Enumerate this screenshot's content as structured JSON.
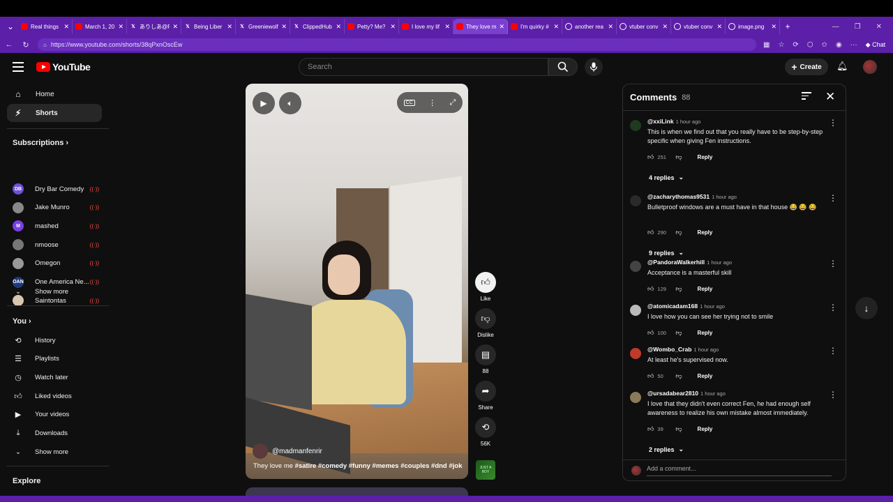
{
  "browser": {
    "tabs": [
      {
        "label": "Real things",
        "favicon": "youtube-icon",
        "active": false
      },
      {
        "label": "March 1, 20",
        "favicon": "youtube-icon",
        "active": false
      },
      {
        "label": "ありしあ@Re",
        "favicon": "x-icon",
        "active": false
      },
      {
        "label": "Being Liber",
        "favicon": "x-icon",
        "active": false
      },
      {
        "label": "Greeniewolf",
        "favicon": "x-icon",
        "active": false
      },
      {
        "label": "ClippedHub",
        "favicon": "x-icon",
        "active": false
      },
      {
        "label": "Petty? Me?",
        "favicon": "youtube-icon",
        "active": false
      },
      {
        "label": "I love my lif",
        "favicon": "youtube-icon",
        "active": false
      },
      {
        "label": "They love m",
        "favicon": "youtube-icon",
        "active": true
      },
      {
        "label": "I'm quirky #",
        "favicon": "youtube-icon",
        "active": false
      },
      {
        "label": "another rea",
        "favicon": "globe-icon",
        "active": false
      },
      {
        "label": "vtuber conv",
        "favicon": "globe-icon",
        "active": false
      },
      {
        "label": "vtuber conv",
        "favicon": "globe-icon",
        "active": false
      },
      {
        "label": "image.png",
        "favicon": "globe-icon",
        "active": false
      }
    ],
    "url": "https://www.youtube.com/shorts/38qPxnOscEw",
    "chat_label": "Chat"
  },
  "masthead": {
    "logo_text": "YouTube",
    "search_placeholder": "Search",
    "create_label": "Create"
  },
  "sidebar": {
    "main": [
      {
        "label": "Home",
        "icon": "home-icon",
        "active": false
      },
      {
        "label": "Shorts",
        "icon": "shorts-icon",
        "active": true
      }
    ],
    "subscriptions_title": "Subscriptions",
    "subscriptions": [
      {
        "label": "Dry Bar Comedy",
        "avatar_text": "DB",
        "color": "#6f4fd8"
      },
      {
        "label": "Jake Munro",
        "avatar_text": "",
        "color": "#888888"
      },
      {
        "label": "mashed",
        "avatar_text": "M",
        "color": "#7b3fe4"
      },
      {
        "label": "nmoose",
        "avatar_text": "",
        "color": "#777777"
      },
      {
        "label": "Omegon",
        "avatar_text": "",
        "color": "#999999"
      },
      {
        "label": "One America Ne...",
        "avatar_text": "OAN",
        "color": "#1f3a7a"
      },
      {
        "label": "Saintontas",
        "avatar_text": "",
        "color": "#d8c7b0"
      }
    ],
    "show_more": "Show more",
    "you_title": "You",
    "you_items": [
      {
        "label": "History",
        "icon": "history-icon"
      },
      {
        "label": "Playlists",
        "icon": "playlists-icon"
      },
      {
        "label": "Watch later",
        "icon": "clock-icon"
      },
      {
        "label": "Liked videos",
        "icon": "thumbs-up-icon"
      },
      {
        "label": "Your videos",
        "icon": "play-square-icon"
      },
      {
        "label": "Downloads",
        "icon": "download-icon"
      }
    ],
    "show_more_2": "Show more",
    "explore_title": "Explore"
  },
  "short": {
    "channel": "@madmanfenrir",
    "caption_title": "They love me",
    "hashtags": "#satire #comedy #funny #memes #couples #dnd #joke...",
    "actions": {
      "like_label": "Like",
      "dislike_label": "Dislike",
      "comments_count": "88",
      "share_label": "Share",
      "remix_count": "56K"
    },
    "sound_thumb_text": "JUST A BOY"
  },
  "comments": {
    "title": "Comments",
    "count": "88",
    "reply_label": "Reply",
    "add_placeholder": "Add a comment...",
    "items": [
      {
        "user": "@xxiLink",
        "time": "1 hour ago",
        "text": "This is when we find out that you really have to be step-by-step specific when giving Fen instructions.",
        "likes": "251",
        "replies": "4 replies",
        "avatar_color": "#1f3a1f"
      },
      {
        "user": "@zacharythomas9531",
        "time": "1 hour ago",
        "text": "Bulletproof windows are a must have in that house 😂 😂 😂",
        "likes": "290",
        "replies": "9 replies",
        "avatar_color": "#2a2a2a"
      },
      {
        "user": "@PandoraWalkerhill",
        "time": "1 hour ago",
        "text": "Acceptance is a masterful skill",
        "likes": "129",
        "replies": "",
        "avatar_color": "#444444"
      },
      {
        "user": "@atomicadam168",
        "time": "1 hour ago",
        "text": "I love how you can see her trying not to smile",
        "likes": "100",
        "replies": "",
        "avatar_color": "#bbbbbb"
      },
      {
        "user": "@Wombo_Crab",
        "time": "1 hour ago",
        "text": "At least he's supervised now.",
        "likes": "50",
        "replies": "",
        "avatar_color": "#c0392b"
      },
      {
        "user": "@ursadabear2810",
        "time": "1 hour ago",
        "text": "I love that they didn't even correct Fen, he had enough self awareness to realize his own mistake almost immediately.",
        "likes": "39",
        "replies": "2 replies",
        "avatar_color": "#8a7a5a"
      }
    ]
  }
}
